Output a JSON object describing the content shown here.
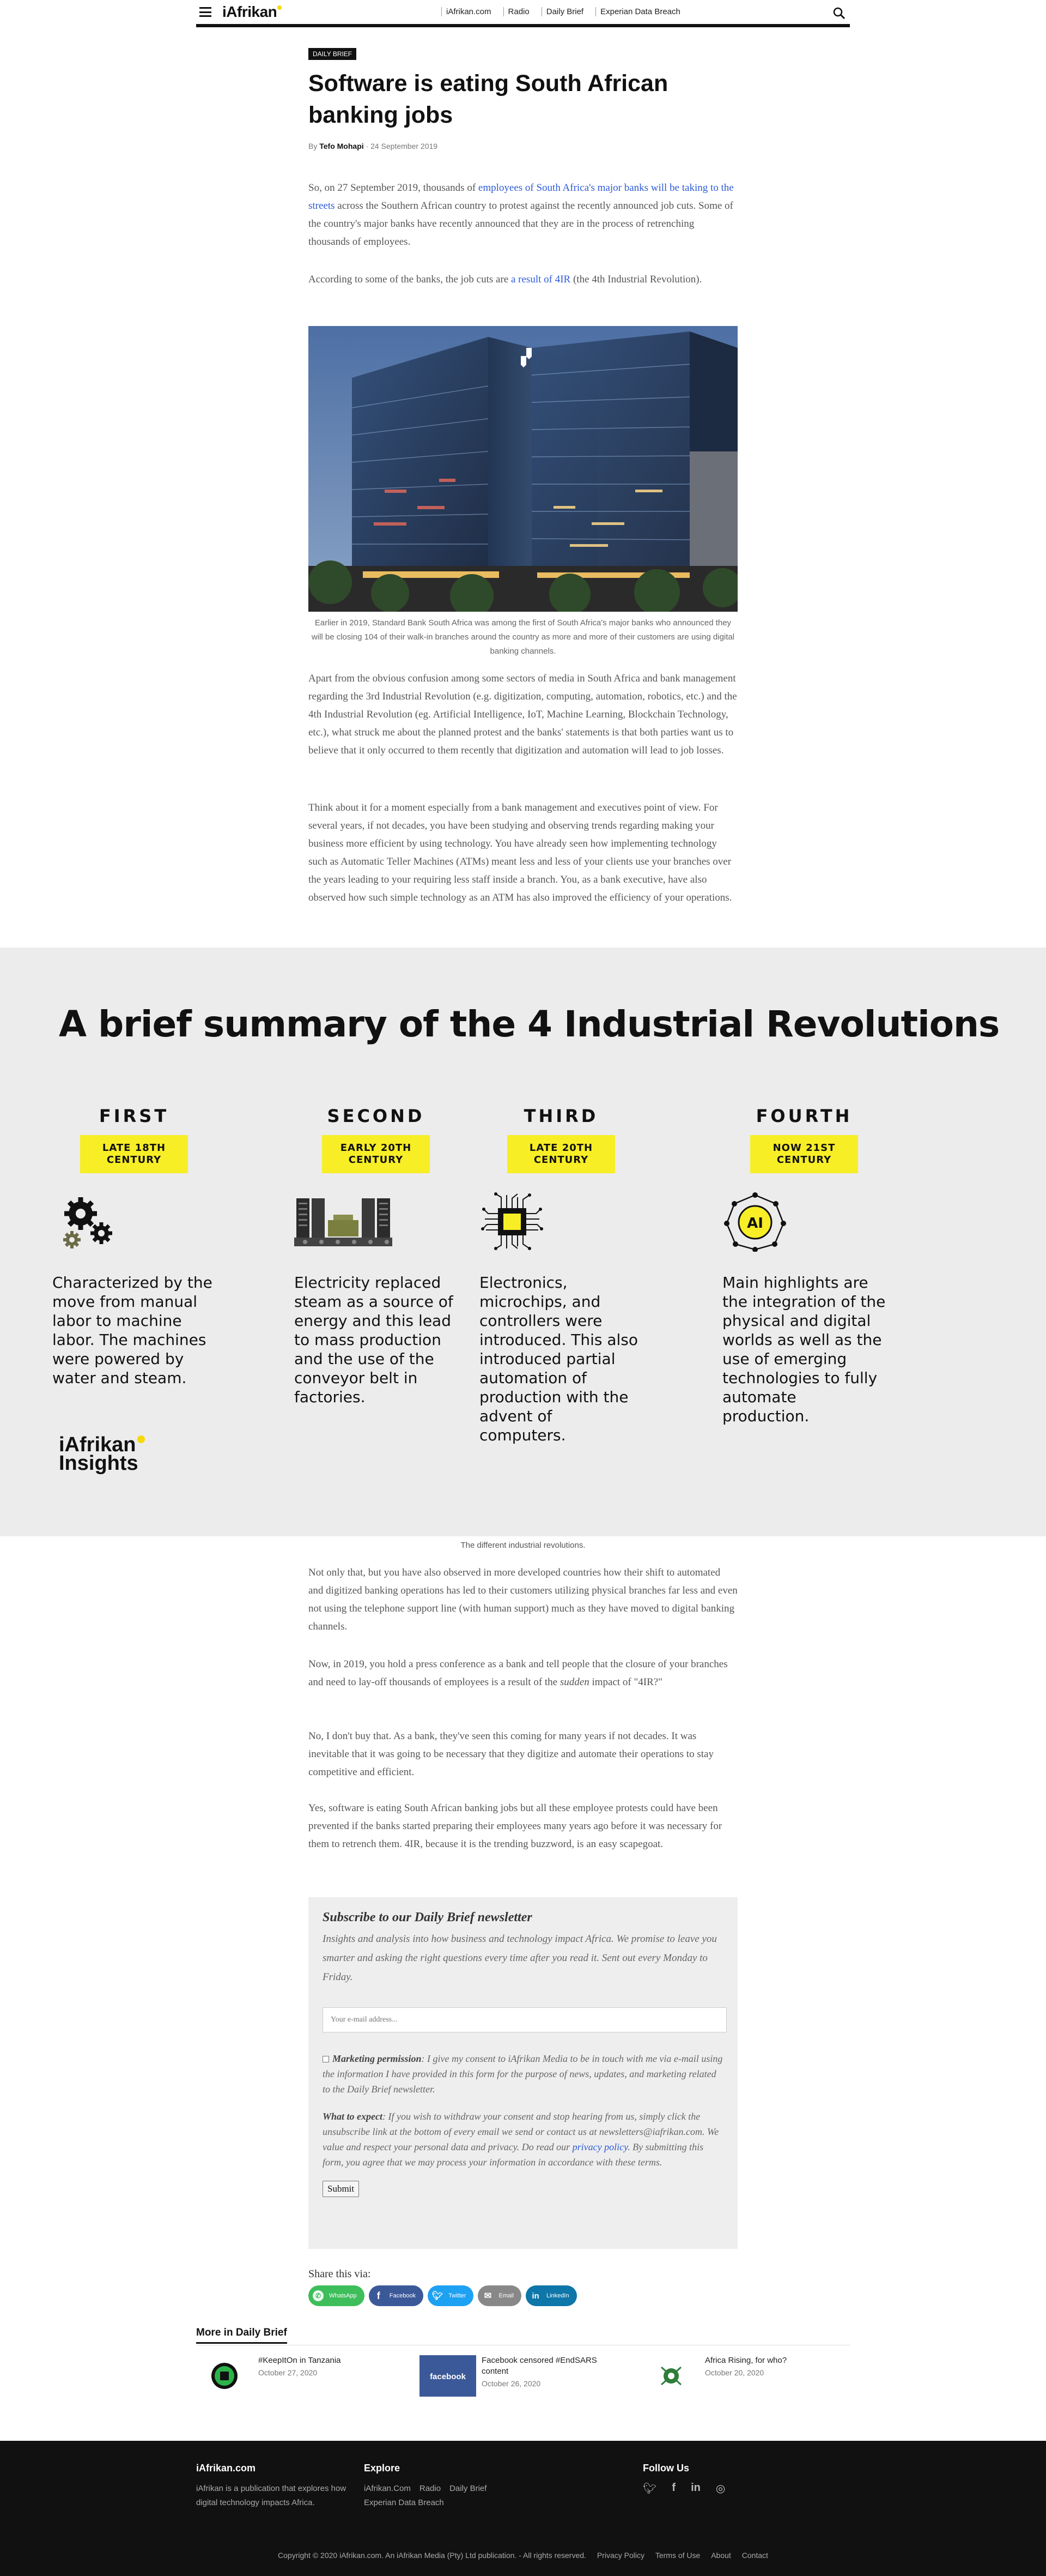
{
  "header": {
    "logo": "iAfrikan",
    "nav": [
      "iAfrikan.com",
      "Radio",
      "Daily Brief",
      "Experian Data Breach"
    ]
  },
  "article": {
    "category": "DAILY BRIEF",
    "title": "Software is eating South African banking jobs",
    "byline_prefix": "By",
    "author": "Tefo Mohapi",
    "date": "24 September 2019",
    "p1_a": "So, on 27 September 2019, thousands of ",
    "p1_link": "employees of South Africa's major banks will be taking to the streets",
    "p1_b": " across the Southern African country to protest against the recently announced job cuts. Some of the country's major banks have recently announced that they are in the process of retrenching thousands of employees.",
    "p2_a": "According to some of the banks, the job cuts are ",
    "p2_link": "a result of 4IR",
    "p2_b": " (the 4th Industrial Revolution).",
    "hero_caption": "Earlier in 2019, Standard Bank South Africa was among the first of South Africa's major banks who announced they will be closing 104 of their walk-in branches around the country as more and more of their customers are using digital banking channels.",
    "p3": "Apart from the obvious confusion among some sectors of media in South Africa and bank management regarding the 3rd Industrial Revolution (e.g. digitization, computing, automation, robotics, etc.) and the 4th Industrial Revolution (eg. Artificial Intelligence, IoT, Machine Learning, Blockchain Technology, etc.), what struck me about the planned protest and the banks' statements is that both parties want us to believe that it only occurred to them recently that digitization and automation will lead to job losses.",
    "p4": "Think about it for a moment especially from a bank management and executives point of view. For several years, if not decades, you have been studying and observing trends regarding making your business more efficient by using technology. You have already seen how implementing technology such as Automatic Teller Machines (ATMs) meant less and less of your clients use your branches over the years leading to your requiring less staff inside a branch. You, as a bank executive, have also observed how such simple technology as an ATM has also improved the efficiency of your operations.",
    "p5": "Not only that, but you have also observed in more developed countries how their shift to automated and digitized banking operations has led to their customers utilizing physical branches far less and even not using the telephone support line (with human support) much as they have moved to digital banking channels.",
    "p6_a": "Now, in 2019, you hold a press conference as a bank and tell people that the closure of your branches and need to lay-off thousands of employees is a result of the ",
    "p6_em": "sudden",
    "p6_b": " impact of \"4IR?\"",
    "p7": "No, I don't buy that. As a bank, they've seen this coming for many years if not decades. It was inevitable that it was going to be necessary that they digitize and automate their operations to stay competitive and efficient.",
    "p8": "Yes, software is eating South African banking jobs but all these employee protests could have been prevented if the banks started preparing their employees many years ago before it was necessary for them to retrench them. 4IR, because it is the trending buzzword, is an easy scapegoat."
  },
  "infographic": {
    "title": "A brief summary of the 4 Industrial Revolutions",
    "brand_line1": "iAfrikan",
    "brand_line2": "Insights",
    "caption": "The different industrial revolutions.",
    "columns": [
      {
        "ordinal": "FIRST",
        "era_1": "LATE 18TH",
        "era_2": "CENTURY",
        "icon": "gears-icon",
        "text": "Characterized by the move from manual labor to machine labor. The machines were powered by water and steam."
      },
      {
        "ordinal": "SECOND",
        "era_1": "EARLY 20TH",
        "era_2": "CENTURY",
        "icon": "factory-icon",
        "text": "Electricity replaced steam as a source of energy and this lead to mass production and the use of the conveyor belt in factories."
      },
      {
        "ordinal": "THIRD",
        "era_1": "LATE 20TH",
        "era_2": "CENTURY",
        "icon": "microchip-icon",
        "text": "Electronics, microchips, and controllers were introduced. This also introduced partial automation of production with the advent of computers."
      },
      {
        "ordinal": "FOURTH",
        "era_1": "NOW 21ST",
        "era_2": "CENTURY",
        "icon": "ai-network-icon",
        "icon_text": "AI",
        "text": "Main highlights are the integration of the physical and digital worlds as well as the use of emerging technologies to fully automate production."
      }
    ]
  },
  "newsletter": {
    "title": "Subscribe to our Daily Brief newsletter",
    "intro": "Insights and analysis into how business and technology impact Africa. We promise to leave you smarter and asking the right questions every time after you read it. Sent out every Monday to Friday.",
    "email_placeholder": "Your e-mail address...",
    "perm_label": "Marketing permission",
    "perm_text": ": I give my consent to iAfrikan Media to be in touch with me via e-mail using the information I have provided in this form for the purpose of news, updates, and marketing related to the Daily Brief newsletter.",
    "expect_label": "What to expect",
    "expect_a": ": If you wish to withdraw your consent and stop hearing from us, simply click the unsubscribe link at the bottom of every email we send or contact us at newsletters@iafrikan.com. We value and respect your personal data and privacy. Do read our ",
    "expect_link": "privacy policy",
    "expect_b": ". By submitting this form, you agree that we may process your information in accordance with these terms.",
    "submit": "Submit"
  },
  "share": {
    "label": "Share this via:",
    "buttons": [
      {
        "label": "WhatsApp",
        "color": "#3dbe5a",
        "icon": "whatsapp-icon"
      },
      {
        "label": "Facebook",
        "color": "#3b5998",
        "icon": "facebook-icon"
      },
      {
        "label": "Twitter",
        "color": "#1da1f2",
        "icon": "twitter-icon"
      },
      {
        "label": "Email",
        "color": "#888888",
        "icon": "email-icon"
      },
      {
        "label": "LinkedIn",
        "color": "#0e76a8",
        "icon": "linkedin-icon"
      }
    ]
  },
  "more": {
    "heading": "More in Daily Brief",
    "cards": [
      {
        "title": "#KeepItOn in Tanzania",
        "date": "October 27, 2020"
      },
      {
        "title": "Facebook censored #EndSARS content",
        "date": "October 26, 2020",
        "thumb_text": "facebook"
      },
      {
        "title": "Africa Rising, for who?",
        "date": "October 20, 2020"
      }
    ]
  },
  "footer": {
    "brand": "iAfrikan.com",
    "about": "iAfrikan is a publication that explores how digital technology impacts Africa.",
    "explore_heading": "Explore",
    "explore_row1": [
      "iAfrikan.Com",
      "Radio",
      "Daily Brief"
    ],
    "explore_row2": "Experian Data Breach",
    "follow_heading": "Follow Us",
    "copyright": "Copyright © 2020 iAfrikan.com. An iAfrikan Media (Pty) Ltd publication. - All rights reserved.",
    "links": [
      "Privacy Policy",
      "Terms of Use",
      "About",
      "Contact"
    ]
  }
}
